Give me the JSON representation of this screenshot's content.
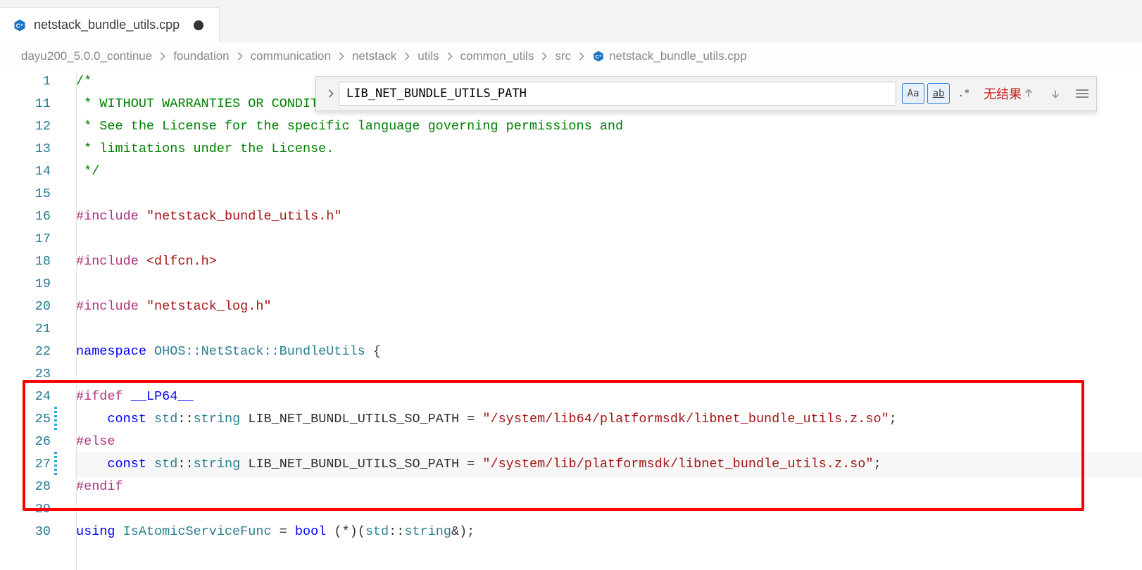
{
  "tab": {
    "filename": "netstack_bundle_utils.cpp",
    "dirty": true
  },
  "breadcrumb": {
    "segments": [
      "dayu200_5.0.0_continue",
      "foundation",
      "communication",
      "netstack",
      "utils",
      "common_utils",
      "src"
    ],
    "file": "netstack_bundle_utils.cpp"
  },
  "find": {
    "query": "LIB_NET_BUNDLE_UTILS_PATH",
    "no_results_label": "无结果",
    "case_label": "Aa",
    "word_label": "ab",
    "regex_label": ".*",
    "case_active": true,
    "word_active": true,
    "regex_active": false
  },
  "gutter_lines": [
    "1",
    "11",
    "12",
    "13",
    "14",
    "15",
    "16",
    "17",
    "18",
    "19",
    "20",
    "21",
    "22",
    "23",
    "24",
    "25",
    "26",
    "27",
    "28",
    "29",
    "30"
  ],
  "code": {
    "l1": "/*",
    "l11a": " * ",
    "l11b": "WITHOUT",
    "l11c": " ",
    "l11d": "WARRANTIES",
    "l11e": " ",
    "l11f": "OR",
    "l11g": " CONDITIONS OF ANY KIND, either express or implied.",
    "l12": " * See the License for the specific language governing permissions and",
    "l13": " * limitations under the License.",
    "l14": " */",
    "inc": "#include",
    "h1": "\"netstack_bundle_utils.h\"",
    "h2": "<dlfcn.h>",
    "h3": "\"netstack_log.h\"",
    "ns_kw": "namespace",
    "ns_name": " OHOS::NetStack::BundleUtils ",
    "brace_open": "{",
    "ifdef": "#ifdef",
    "lp64": "__LP64__",
    "else": "#else",
    "endif": "#endif",
    "const_kw": "const",
    "std_ns": "std",
    "scope": "::",
    "string_t": "string",
    "var": "LIB_NET_BUNDL_UTILS_SO_PATH",
    "eq": " = ",
    "path64": "\"/system/lib64/platformsdk/libnet_bundle_utils.z.so\"",
    "path32": "\"/system/lib/platformsdk/libnet_bundle_utils.z.so\"",
    "semi": ";",
    "using_kw": "using",
    "alias": "IsAtomicServiceFunc",
    "eq2": " = ",
    "bool_t": "bool",
    "fnptr": " (*)(",
    "amp_paren": "&);"
  }
}
